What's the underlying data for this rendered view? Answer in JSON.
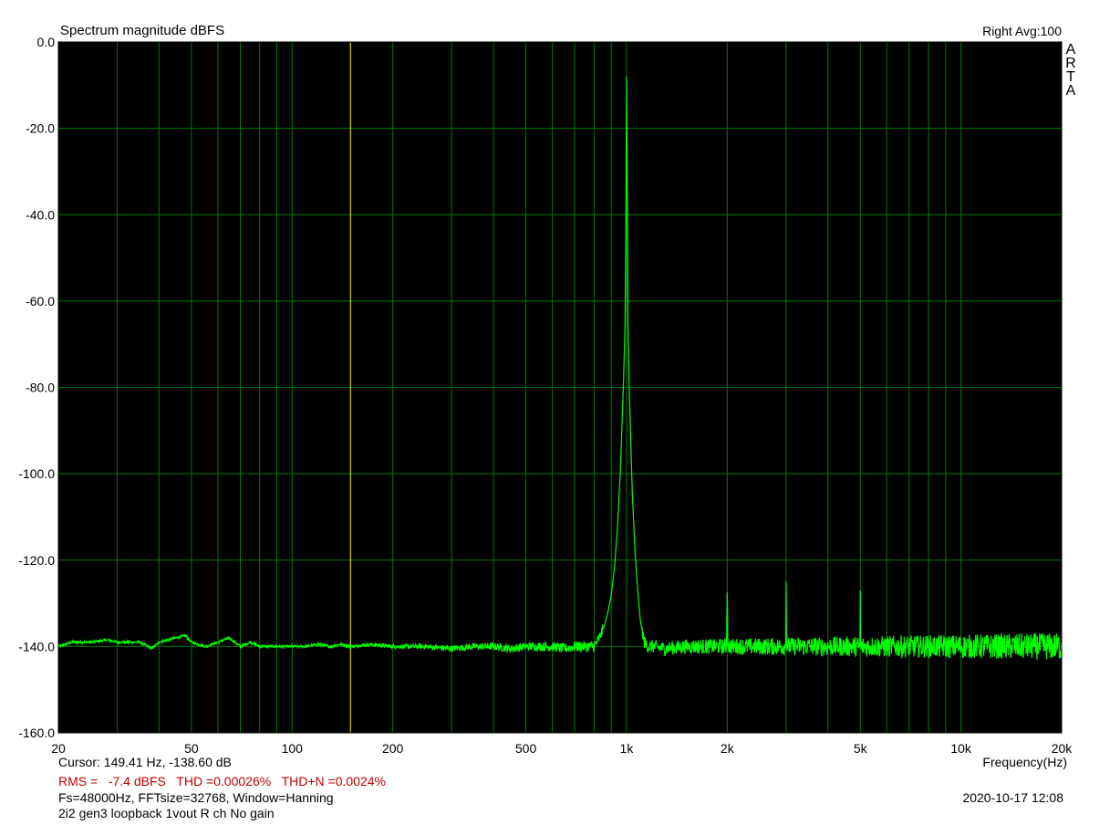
{
  "header": {
    "title": "Spectrum magnitude dBFS",
    "channel_info": "Right  Avg:100",
    "brand_letters": [
      "A",
      "R",
      "T",
      "A"
    ]
  },
  "footer": {
    "cursor_readout": "Cursor: 149.41 Hz, -138.60 dB",
    "measurements": "RMS =   -7.4 dBFS   THD =0.00026%   THD+N =0.0024%",
    "fft_settings": "Fs=48000Hz, FFTsize=32768, Window=Hanning",
    "datetime": "2020-10-17  12:08",
    "note": "2i2 gen3 loopback 1vout R ch No gain"
  },
  "colors": {
    "plot_background": "#000000",
    "grid": "#007a00",
    "trace": "#00ff00",
    "cursor": "#ffff00",
    "measurement_text": "#c00000"
  },
  "chart_data": {
    "type": "line",
    "x_scale": "log",
    "xlabel": "Frequency(Hz)",
    "ylabel": "",
    "xlim": [
      20,
      20000
    ],
    "ylim": [
      -160,
      0
    ],
    "grid": true,
    "y_ticks": [
      0,
      -20,
      -40,
      -60,
      -80,
      -100,
      -120,
      -140,
      -160
    ],
    "y_tick_labels": [
      "0.0",
      "-20.0",
      "-40.0",
      "-60.0",
      "-80.0",
      "-100.0",
      "-120.0",
      "-140.0",
      "-160.0"
    ],
    "x_ticks": [
      20,
      50,
      100,
      200,
      500,
      1000,
      2000,
      5000,
      10000,
      20000
    ],
    "x_tick_labels": [
      "20",
      "50",
      "100",
      "200",
      "500",
      "1k",
      "2k",
      "5k",
      "10k",
      "20k"
    ],
    "cursor_x": 149.41,
    "series": [
      {
        "x": [
          20,
          22,
          25,
          28,
          30,
          35,
          38,
          40,
          45,
          48,
          50,
          55,
          60,
          65,
          70,
          75,
          80,
          90,
          100,
          110,
          120,
          130,
          140,
          150,
          170,
          200,
          250,
          300,
          350,
          400,
          450,
          500,
          550,
          600,
          650,
          700,
          750,
          800,
          830,
          860,
          880,
          900,
          920,
          940,
          960,
          980,
          990,
          995,
          1000,
          1005,
          1010,
          1020,
          1040,
          1060,
          1080,
          1100,
          1130,
          1160,
          1200,
          1300,
          1500,
          1800,
          1990,
          2000,
          2010,
          2500,
          2990,
          3000,
          3010,
          4000,
          4990,
          5000,
          5010,
          6000,
          7000,
          8000,
          10000,
          12000,
          14000,
          15000,
          17000,
          20000
        ],
        "y": [
          -140,
          -139,
          -139,
          -138.5,
          -139,
          -139,
          -140.5,
          -139,
          -138,
          -137.5,
          -139,
          -140,
          -139,
          -138,
          -140,
          -139,
          -140,
          -140,
          -140,
          -140,
          -139.5,
          -140,
          -139.5,
          -140,
          -139.5,
          -140,
          -140,
          -140.5,
          -140,
          -140,
          -140.5,
          -140,
          -140,
          -140,
          -140.5,
          -140,
          -140,
          -140,
          -138,
          -135,
          -132,
          -128,
          -122,
          -112,
          -98,
          -78,
          -65,
          -45,
          -8,
          -36,
          -66,
          -82,
          -104,
          -118,
          -127,
          -134,
          -139,
          -140,
          -140,
          -140.5,
          -140,
          -140,
          -140,
          -127.5,
          -140,
          -140,
          -140,
          -125,
          -140,
          -140,
          -140,
          -127,
          -140,
          -140,
          -140,
          -140,
          -140,
          -140,
          -140,
          -140,
          -140,
          -140
        ]
      }
    ]
  }
}
